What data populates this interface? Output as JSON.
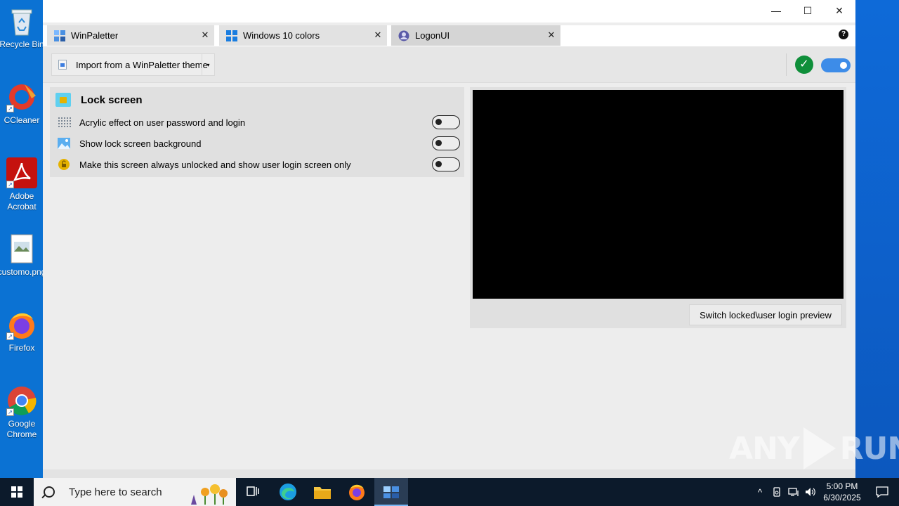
{
  "desktop": {
    "icons": [
      {
        "label": "Recycle Bin",
        "icon": "recycle-bin-icon"
      },
      {
        "label": "CCleaner",
        "icon": "ccleaner-icon"
      },
      {
        "label": "Adobe Acrobat",
        "icon": "adobe-acrobat-icon"
      },
      {
        "label": "customo.png",
        "icon": "image-file-icon"
      },
      {
        "label": "Firefox",
        "icon": "firefox-icon"
      },
      {
        "label": "Google Chrome",
        "icon": "chrome-icon"
      }
    ]
  },
  "window": {
    "controls": {
      "minimize": "—",
      "maximize": "☐",
      "close": "✕"
    },
    "tabs": [
      {
        "label": "WinPaletter",
        "icon": "winpaletter-icon",
        "close": "✕"
      },
      {
        "label": "Windows 10 colors",
        "icon": "windows-logo-icon",
        "close": "✕"
      },
      {
        "label": "LogonUI",
        "icon": "user-icon",
        "close": "✕"
      }
    ],
    "help": "?"
  },
  "toolbar": {
    "import_label": "Import from a WinPaletter theme",
    "dropdown_arrow": "▾",
    "status_icon": "checkmark-icon",
    "status_glyph": "✓",
    "enabled": true
  },
  "lock_screen": {
    "title": "Lock screen",
    "options": [
      {
        "label": "Acrylic effect on user password and login",
        "enabled": false,
        "icon": "acrylic-dots-icon"
      },
      {
        "label": "Show lock screen background",
        "enabled": false,
        "icon": "landscape-image-icon"
      },
      {
        "label": "Make this screen always unlocked and show user login screen only",
        "enabled": false,
        "icon": "lock-coin-icon"
      }
    ]
  },
  "preview": {
    "button_label": "Switch locked\\user login preview"
  },
  "watermark": {
    "left": "ANY",
    "right": "RUN"
  },
  "taskbar": {
    "search_placeholder": "Type here to search",
    "apps": [
      "task-view-icon",
      "edge-icon",
      "file-explorer-icon",
      "firefox-icon",
      "winpaletter-icon"
    ],
    "tray_up": "^",
    "time": "5:00 PM",
    "date": "6/30/2025"
  },
  "colors": {
    "desktop": "#0b72d3",
    "accent": "#3d8ce8",
    "ok": "#0f8f3a",
    "taskbar": "#0c1a2b"
  }
}
